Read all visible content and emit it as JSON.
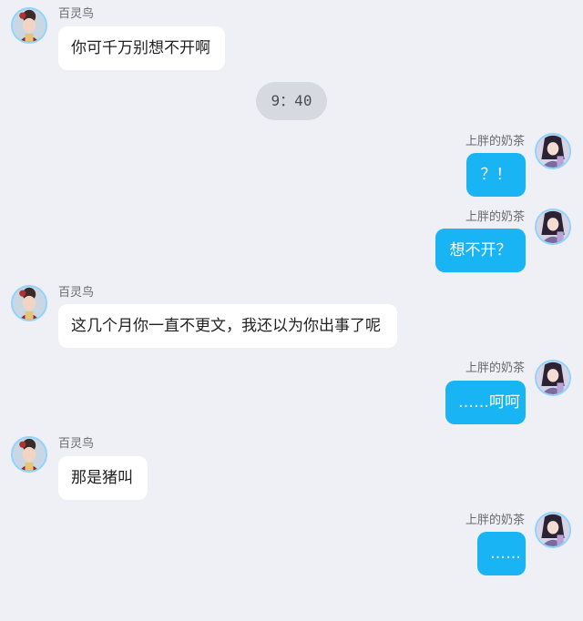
{
  "contacts": {
    "other": {
      "name": "百灵鸟"
    },
    "self": {
      "name": "上胖的奶茶"
    }
  },
  "messages": [
    {
      "sender": "百灵鸟",
      "text": "你可千万别想不开啊"
    },
    {
      "sender": "上胖的奶茶",
      "text": "？！"
    },
    {
      "sender": "上胖的奶茶",
      "text": "想不开？"
    },
    {
      "sender": "百灵鸟",
      "text": "这几个月你一直不更文，我还以为你出事了呢"
    },
    {
      "sender": "上胖的奶茶",
      "text": "……呵呵"
    },
    {
      "sender": "百灵鸟",
      "text": "那是猪叫"
    },
    {
      "sender": "上胖的奶茶",
      "text": "……"
    }
  ],
  "timestamp": "9：40",
  "colors": {
    "background": "#eef0f5",
    "incoming_bubble": "#ffffff",
    "outgoing_bubble": "#18b4f3",
    "timestamp_pill": "#d7d9e1"
  }
}
